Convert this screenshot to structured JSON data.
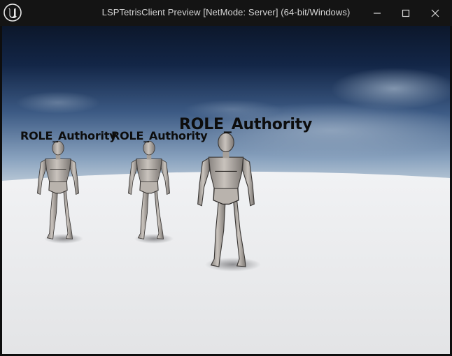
{
  "window": {
    "title": "LSPTetrisClient Preview [NetMode: Server]  (64-bit/Windows)",
    "app_icon": "unreal-engine-logo",
    "controls": {
      "minimize_icon": "minimize-icon",
      "maximize_icon": "maximize-icon",
      "close_icon": "close-icon"
    }
  },
  "viewport": {
    "labels": [
      "ROLE_Authority",
      "ROLE_Authority",
      "ROLE_Authority"
    ],
    "colors": {
      "sky_top": "#0d1a30",
      "sky_horizon": "#a9bcd0",
      "floor": "#e9eaec",
      "label_text": "#0d0d0d"
    }
  }
}
